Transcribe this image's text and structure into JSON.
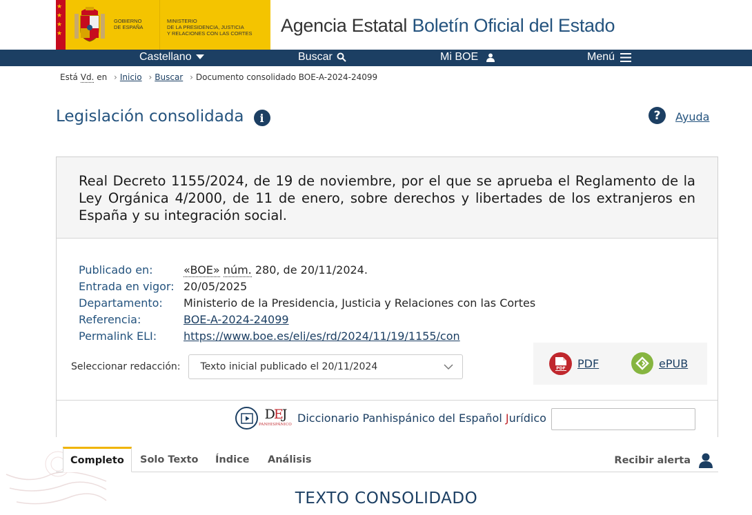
{
  "header": {
    "gov_line1": "Gobierno",
    "gov_line2": "de España",
    "ministry_line1": "Ministerio",
    "ministry_line2": "de la Presidencia, Justicia",
    "ministry_line3": "y Relaciones con las Cortes",
    "agency_prefix": "Agencia Estatal",
    "agency_name": "Boletín Oficial del Estado",
    "flag_stars": "★\n★\n★\n★"
  },
  "nav": {
    "language": "Castellano",
    "search": "Buscar",
    "my_boe": "Mi BOE",
    "menu": "Menú"
  },
  "breadcrumb": {
    "prefix_a": "Está",
    "prefix_abbr": "Vd.",
    "prefix_b": "en",
    "home": "Inicio",
    "search": "Buscar",
    "current": "Documento consolidado BOE-A-2024-24099"
  },
  "page": {
    "title": "Legislación consolidada",
    "info_glyph": "i",
    "help_glyph": "?",
    "help_label": "Ayuda"
  },
  "document": {
    "title": "Real Decreto 1155/2024, de 19 de noviembre, por el que se aprueba el Reglamento de la Ley Orgánica 4/2000, de 11 de enero, sobre derechos y libertades de los extranjeros en España y su integración social.",
    "published_label": "Publicado en:",
    "published_boe": "«BOE»",
    "published_num": "núm.",
    "published_rest": " 280, de 20/11/2024.",
    "in_force_label": "Entrada en vigor:",
    "in_force_value": "20/05/2025",
    "department_label": "Departamento:",
    "department_value": "Ministerio de la Presidencia, Justicia y Relaciones con las Cortes",
    "reference_label": "Referencia:",
    "reference_value": "BOE-A-2024-24099",
    "eli_label": "Permalink ELI:",
    "eli_value": "https://www.boe.es/eli/es/rd/2024/11/19/1155/con"
  },
  "redaccion": {
    "label": "Seleccionar redacción:",
    "selected": "Texto inicial publicado el 20/11/2024"
  },
  "downloads": {
    "pdf": "PDF",
    "epub": "ePUB",
    "pdf_icon_text": "PDF"
  },
  "dictionary": {
    "logo_d": "D",
    "logo_e": "E",
    "logo_j": "J",
    "logo_sub": "PANHISPÁNICO",
    "label_a": "Diccionario Panhispánico del Español ",
    "label_j": "J",
    "label_b": "urídico"
  },
  "tabs": {
    "complete": "Completo",
    "text_only": "Solo Texto",
    "index": "Índice",
    "analysis": "Análisis",
    "alert": "Recibir alerta"
  },
  "section": {
    "title": "TEXTO CONSOLIDADO"
  },
  "colors": {
    "navy": "#1c3f63",
    "gold": "#f4c400",
    "pdf_red": "#c0272d",
    "epub_green": "#86b540"
  }
}
